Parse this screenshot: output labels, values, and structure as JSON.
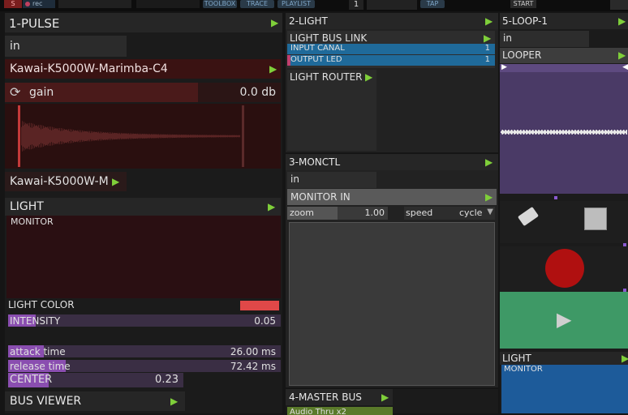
{
  "topbar": {
    "record_label": "rec",
    "s_label": "S",
    "time_partial": "1",
    "buttons": [
      "TOOLBOX",
      "TRACE",
      "PLAYLIST"
    ],
    "tap_label": "TAP",
    "start_label": "START",
    "counter": "1"
  },
  "pulse": {
    "title": "1-PULSE",
    "input": "in",
    "instrument": "Kawai-K5000W-Marimba-C4",
    "gain_label": "gain",
    "gain_value": "0.0 db",
    "instrument_short": "Kawai-K5000W-M",
    "light_title": "LIGHT",
    "monitor_label": "MONITOR",
    "light_color_label": "LIGHT COLOR",
    "light_color": "#e04848",
    "intensity_label": "INTENSITY",
    "intensity_value": "0.05",
    "attack_label": "attack time",
    "attack_value": "26.00 ms",
    "release_label": "release time",
    "release_value": "72.42 ms",
    "center_label": "CENTER",
    "center_value": "0.23",
    "bus_viewer": "BUS VIEWER",
    "intensity_fraction": 0.1,
    "attack_fraction": 0.13,
    "release_fraction": 0.21,
    "center_fraction": 0.23
  },
  "light": {
    "title": "2-LIGHT",
    "bus_link": "LIGHT BUS LINK",
    "row1_label": "INPUT  CANAL",
    "row1_value": "1",
    "row2_label": "OUTPUT LED",
    "row2_value": "1",
    "router": "LIGHT ROUTER"
  },
  "monctl": {
    "title": "3-MONCTL",
    "input": "in",
    "monitor_in": "MONITOR IN",
    "zoom_label": "zoom",
    "zoom_value": "1.00",
    "speed_label": "speed",
    "speed_value": "cycle"
  },
  "master": {
    "title": "4-MASTER BUS",
    "item": "Audio Thru x2"
  },
  "loop": {
    "title": "5-LOOP-1",
    "input": "in",
    "looper": "LOOPER",
    "light_title": "LIGHT",
    "monitor_label": "MONITOR"
  }
}
